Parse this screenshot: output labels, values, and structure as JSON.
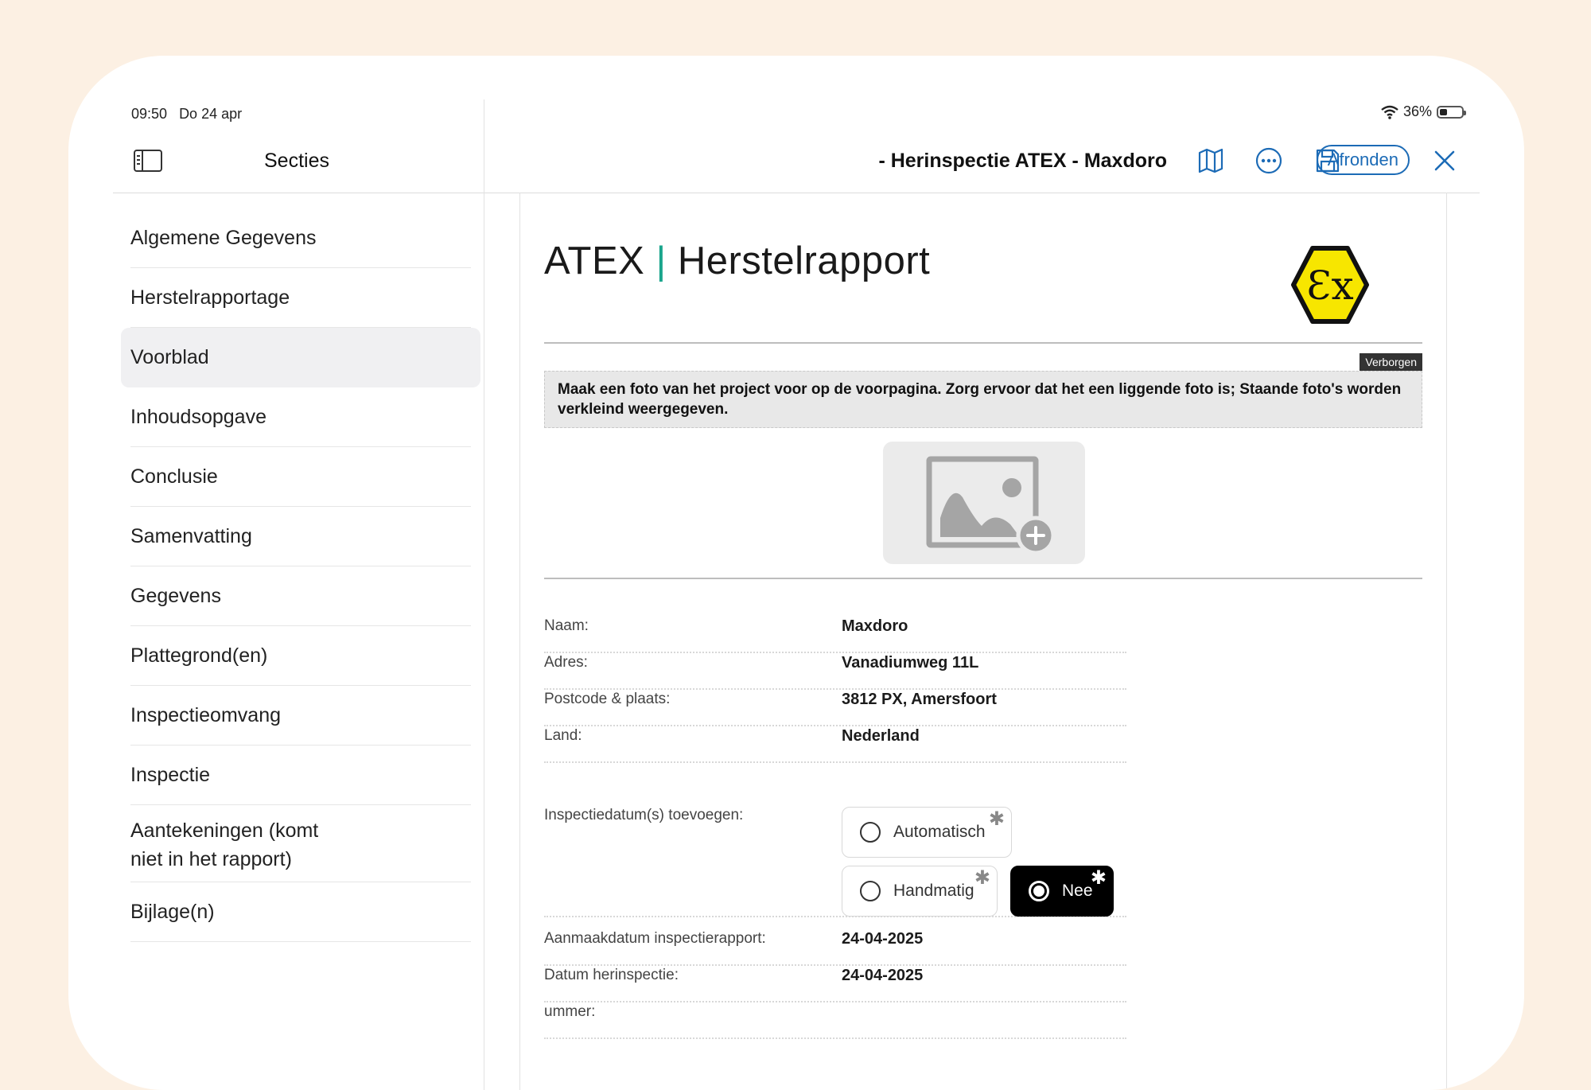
{
  "status_bar": {
    "time": "09:50",
    "date": "Do 24 apr",
    "battery": "36%",
    "battery_level": 0.36
  },
  "sidebar": {
    "title": "Secties",
    "items": [
      {
        "label": "Algemene Gegevens",
        "active": false
      },
      {
        "label": "Herstelrapportage",
        "active": false
      },
      {
        "label": "Voorblad",
        "active": true
      },
      {
        "label": "Inhoudsopgave",
        "active": false
      },
      {
        "label": "Conclusie",
        "active": false
      },
      {
        "label": "Samenvatting",
        "active": false
      },
      {
        "label": "Gegevens",
        "active": false
      },
      {
        "label": "Plattegrond(en)",
        "active": false
      },
      {
        "label": "Inspectieomvang",
        "active": false
      },
      {
        "label": "Inspectie",
        "active": false
      },
      {
        "label": "Aantekeningen (komt niet in het rapport)",
        "active": false
      },
      {
        "label": "Bijlage(n)",
        "active": false
      }
    ]
  },
  "toolbar": {
    "title": "- Herinspectie ATEX - Maxdoro",
    "finish_label": "Afronden",
    "icons": [
      "map-icon",
      "more-icon",
      "save-icon",
      "close-icon"
    ]
  },
  "report": {
    "title_left": "ATEX",
    "title_separator": "|",
    "title_right": "Herstelrapport",
    "logo_text": "Ɛx",
    "hidden_badge": "Verborgen",
    "photo_note": "Maak een foto van het project voor op de voorpagina. Zorg ervoor dat het een liggende foto is; Staande foto's worden verkleind weergegeven.",
    "fields": [
      {
        "label": "Naam:",
        "value": "Maxdoro"
      },
      {
        "label": "Adres:",
        "value": "Vanadiumweg 11L"
      },
      {
        "label": "Postcode & plaats:",
        "value": "3812 PX, Amersfoort"
      },
      {
        "label": "Land:",
        "value": "Nederland"
      }
    ],
    "inspection_date": {
      "label": "Inspectiedatum(s) toevoegen:",
      "options": [
        {
          "label": "Automatisch",
          "selected": false
        },
        {
          "label": "Handmatig",
          "selected": false
        },
        {
          "label": "Nee",
          "selected": true
        }
      ]
    },
    "fields2": [
      {
        "label": "Aanmaakdatum inspectierapport:",
        "value": "24-04-2025"
      },
      {
        "label": "Datum herinspectie:",
        "value": "24-04-2025"
      },
      {
        "label": "ummer:",
        "value": ""
      }
    ]
  },
  "colors": {
    "accent": "#1c6bb6",
    "brand_bar": "#1aa58c",
    "ex_yellow": "#f7e600"
  }
}
